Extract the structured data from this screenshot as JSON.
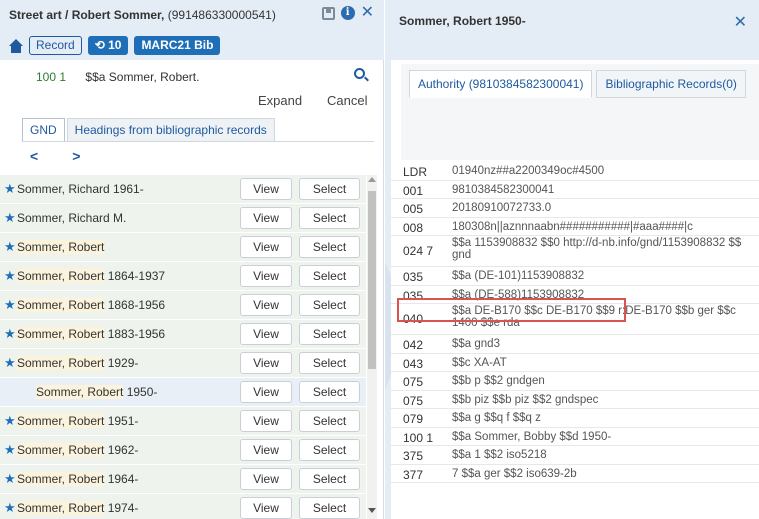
{
  "left": {
    "title_bold": "Street art / Robert Sommer,",
    "title_id": "(991486330000541)",
    "badges": {
      "record": "Record",
      "count": "10",
      "type": "MARC21 Bib"
    },
    "field": {
      "tag": "100",
      "ind": "1",
      "value": "$$a Sommer, Robert."
    },
    "expand": "Expand",
    "cancel": "Cancel",
    "tabs": [
      "GND",
      "Headings from bibliographic records"
    ],
    "pager": {
      "prev": "<",
      "next": ">"
    },
    "rows": [
      {
        "star": true,
        "name": "Sommer, Richard 1961-",
        "mark": ""
      },
      {
        "star": true,
        "name": "Sommer, Richard M.",
        "mark": ""
      },
      {
        "star": true,
        "name": "",
        "mark": "Sommer, Robert"
      },
      {
        "star": true,
        "name": " 1864-1937",
        "mark": "Sommer, Robert"
      },
      {
        "star": true,
        "name": " 1868-1956",
        "mark": "Sommer, Robert"
      },
      {
        "star": true,
        "name": " 1883-1956",
        "mark": "Sommer, Robert"
      },
      {
        "star": true,
        "name": " 1929-",
        "mark": "Sommer, Robert"
      },
      {
        "star": false,
        "name": " 1950-",
        "mark": "Sommer, Robert"
      },
      {
        "star": true,
        "name": " 1951-",
        "mark": "Sommer, Robert"
      },
      {
        "star": true,
        "name": " 1962-",
        "mark": "Sommer, Robert"
      },
      {
        "star": true,
        "name": " 1964-",
        "mark": "Sommer, Robert"
      },
      {
        "star": true,
        "name": " 1974-",
        "mark": "Sommer, Robert"
      }
    ],
    "view_label": "View",
    "select_label": "Select"
  },
  "right": {
    "title": "Sommer, Robert 1950-",
    "tabs": [
      "Authority (9810384582300041)",
      "Bibliographic Records(0)"
    ],
    "marc": [
      {
        "tag": "LDR",
        "val": "01940nz##a2200349oc#4500"
      },
      {
        "tag": "001",
        "val": "9810384582300041"
      },
      {
        "tag": "005",
        "val": "20180910072733.0"
      },
      {
        "tag": "008",
        "val": "180308n||aznnnaabn###########|#aaa####|c"
      },
      {
        "tag": "024 7",
        "val": "$$a 1153908832 $$0 http://d-nb.info/gnd/1153908832 $$ gnd",
        "tall": true
      },
      {
        "tag": "035",
        "val": "$$a (DE-101)1153908832"
      },
      {
        "tag": "035",
        "val": "$$a (DE-588)1153908832"
      },
      {
        "tag": "040",
        "val": "$$a DE-B170 $$c DE-B170 $$9 r:DE-B170 $$b ger $$c 1400 $$e rda",
        "tall": true
      },
      {
        "tag": "042",
        "val": "$$a gnd3"
      },
      {
        "tag": "043",
        "val": "$$c XA-AT"
      },
      {
        "tag": "075",
        "val": "$$b p $$2 gndgen"
      },
      {
        "tag": "075",
        "val": "$$b piz $$b piz $$2 gndspec"
      },
      {
        "tag": "079",
        "val": "$$a g $$q f $$q z"
      },
      {
        "tag": "100 1",
        "val": "$$a Sommer, Bobby $$d 1950-"
      },
      {
        "tag": "375",
        "val": "$$a 1 $$2 iso5218"
      },
      {
        "tag": "377",
        "val": "7 $$a ger $$2 iso639-2b"
      }
    ]
  }
}
